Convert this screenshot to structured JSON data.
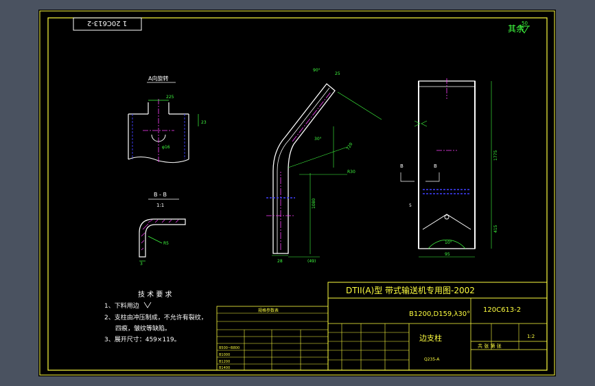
{
  "drawing": {
    "code_box": "1 20C613-2",
    "surface_finish": "其余",
    "finish_value": "50",
    "view_a_title": "A向旋转",
    "view_a_dims": [
      "225",
      "φ16",
      "23"
    ],
    "section_title": "B - B",
    "section_scale": "1:1",
    "section_dims": [
      "R5",
      "3"
    ],
    "bent_dims": [
      "90°",
      "25",
      "30°",
      "R30",
      "720",
      "1080",
      "28",
      "(49)"
    ],
    "right_dims": [
      "1775",
      "415",
      "95",
      "10°",
      "B",
      "B",
      "5"
    ],
    "tech_title": "技 术 要 求",
    "tech_items": [
      "1、下料用边",
      "2、支柱由冲压制成，不允许有裂纹，",
      "四痕，皱纹等缺陷。",
      "3、展开尺寸：459×119。"
    ],
    "title_block": {
      "main_title": "DTII(A)型  带式输送机专用图-2002",
      "spec": "B1200,D159,λ30°",
      "drawing_no": "120C613-2",
      "part_name": "边支柱",
      "scale_label": "1:2",
      "material": "Q235-A",
      "sheet_label": "共  张  第  张"
    },
    "param_table": {
      "title": "规格参数表",
      "rows": [
        "B500~B800",
        "B1000",
        "B1200",
        "B1400"
      ]
    }
  },
  "colors": {
    "background": "#000000",
    "frame": "#ffff40",
    "geometry": "#ffffff",
    "dimension": "#40ff40",
    "center": "#ff40ff",
    "hidden": "#4040ff"
  }
}
